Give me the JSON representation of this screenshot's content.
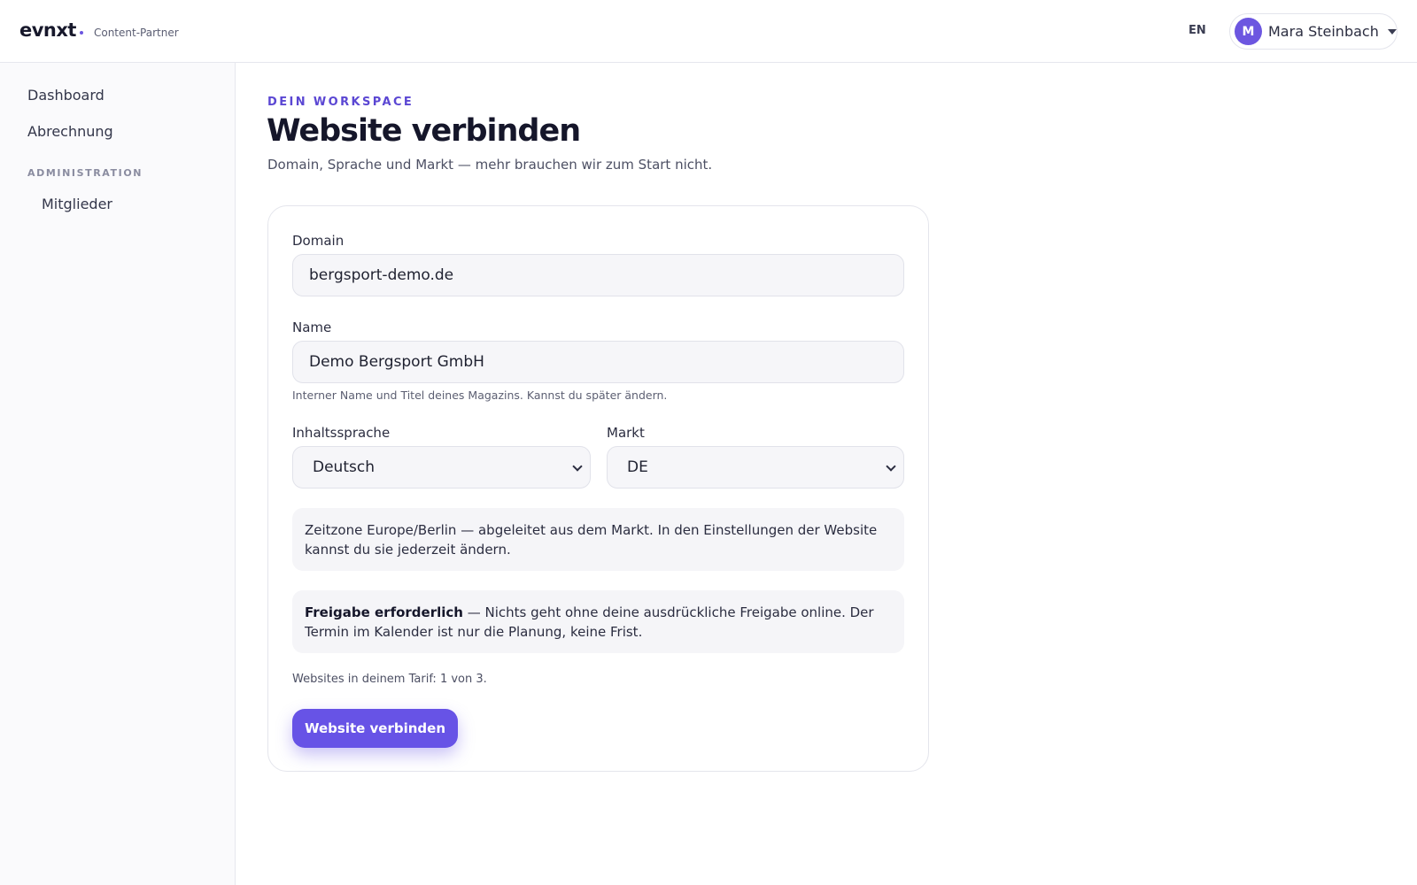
{
  "header": {
    "brand": "evnxt",
    "brand_subtitle": "Content-Partner",
    "language_toggle": "EN",
    "user": {
      "initial": "M",
      "name": "Mara Steinbach"
    }
  },
  "sidebar": {
    "items": [
      {
        "label": "Dashboard"
      },
      {
        "label": "Abrechnung"
      }
    ],
    "section_admin": "ADMINISTRATION",
    "admin_items": [
      {
        "label": "Mitglieder"
      }
    ]
  },
  "main": {
    "eyebrow": "DEIN WORKSPACE",
    "title": "Website verbinden",
    "subtitle": "Domain, Sprache und Markt — mehr brauchen wir zum Start nicht.",
    "form": {
      "domain_label": "Domain",
      "domain_value": "bergsport-demo.de",
      "name_label": "Name",
      "name_value": "Demo Bergsport GmbH",
      "name_hint": "Interner Name und Titel deines Magazins. Kannst du später ändern.",
      "language_label": "Inhaltssprache",
      "language_value": "Deutsch",
      "market_label": "Markt",
      "market_value": "DE",
      "timezone_note": "Zeitzone Europe/Berlin — abgeleitet aus dem Markt. In den Einstellungen der Website kannst du sie jederzeit ändern.",
      "approval_title": "Freigabe erforderlich",
      "approval_text": " — Nichts geht ohne deine ausdrückliche Freigabe online. Der Termin im Kalender ist nur die Planung, keine Frist.",
      "quota_text": "Websites in deinem Tarif: 1 von 3.",
      "submit_label": "Website verbinden"
    }
  },
  "colors": {
    "accent": "#6753e6",
    "eyebrow": "#5b47d3",
    "sidebar_bg": "#fafafc"
  }
}
